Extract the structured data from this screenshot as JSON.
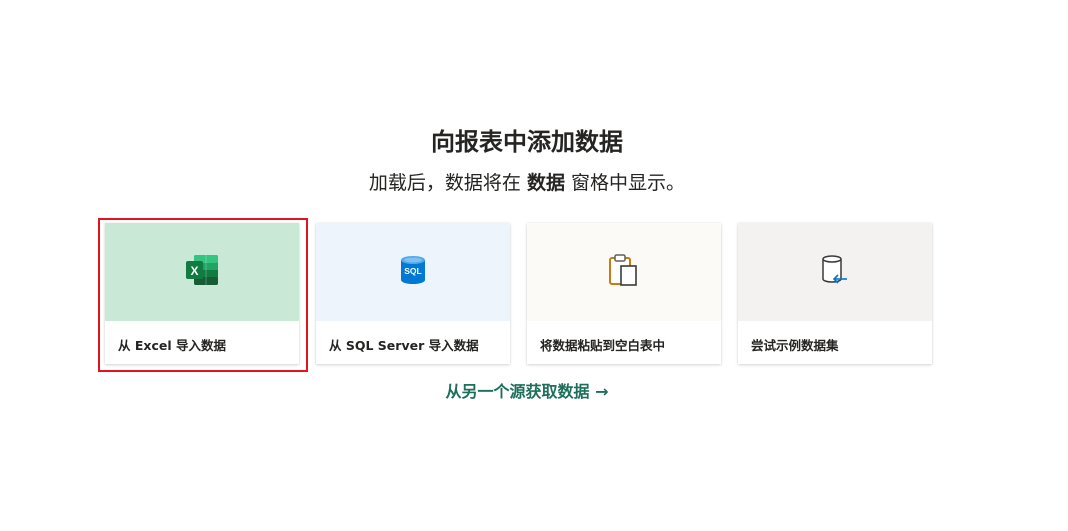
{
  "header": {
    "title": "向报表中添加数据",
    "subtitle_before": "加载后，数据将在",
    "subtitle_bold": "数据",
    "subtitle_after": "窗格中显示。"
  },
  "cards": [
    {
      "label": "从 Excel 导入数据",
      "icon": "excel-icon",
      "bg": "#c9e8d6"
    },
    {
      "label": "从 SQL Server 导入数据",
      "icon": "sql-database-icon",
      "bg": "#edf4fb"
    },
    {
      "label": "将数据粘贴到空白表中",
      "icon": "clipboard-paste-icon",
      "bg": "#fbfaf6"
    },
    {
      "label": "尝试示例数据集",
      "icon": "sample-dataset-icon",
      "bg": "#f3f2f1"
    }
  ],
  "sql_icon_text": "SQL",
  "excel_icon_text": "X",
  "other_source_link": "从另一个源获取数据 →",
  "colors": {
    "link": "#1d6f5c",
    "highlight": "#e0161c",
    "excel_green": "#107c41",
    "sql_blue": "#0078d4"
  }
}
